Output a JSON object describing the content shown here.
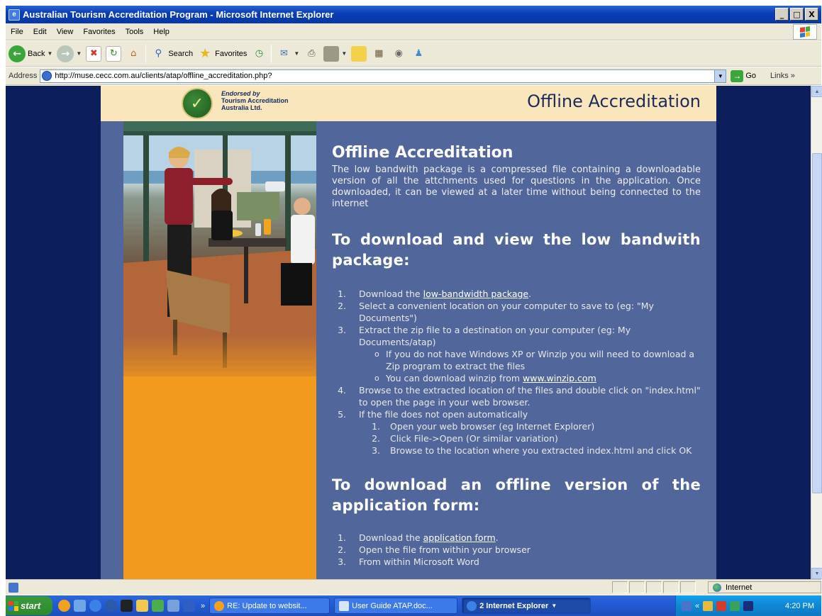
{
  "window": {
    "title": "Australian Tourism Accreditation Program - Microsoft Internet Explorer",
    "buttons": [
      "_",
      "□",
      "X"
    ]
  },
  "menu": [
    "File",
    "Edit",
    "View",
    "Favorites",
    "Tools",
    "Help"
  ],
  "toolbar": {
    "back_label": "Back",
    "search_label": "Search",
    "favorites_label": "Favorites"
  },
  "address": {
    "label": "Address",
    "url": "http://muse.cecc.com.au/clients/atap/offline_accreditation.php?",
    "go_label": "Go",
    "links_label": "Links »"
  },
  "page": {
    "endorsement": [
      "Endorsed by",
      "Tourism Accreditation",
      "Australia Ltd."
    ],
    "header_title": "Offline Accreditation",
    "heading": "Offline Accreditation",
    "intro": "The low bandwith package is a compressed file containing a downloadable version of all the attchments used for questions in the application. Once downloaded, it can be viewed at a later time without being connected to the internet",
    "section1": {
      "heading": "To download and view the low bandwith package:",
      "step1_prefix": "Download the ",
      "step1_link": "low-bandwidth package",
      "step1_suffix": ".",
      "step2": "Select a convenient location on your computer to save to (eg: \"My Documents\")",
      "step3": "Extract the zip file to a destination on your computer (eg: My Documents/atap)",
      "step3_sub1": "If you do not have Windows XP or Winzip you will need to download a Zip program to extract the files",
      "step3_sub2_prefix": "You can download winzip from ",
      "step3_sub2_link": "www.winzip.com",
      "step4": "Browse to the extracted location of the files and double click on \"index.html\" to open the page in your web browser.",
      "step5": "If the file does not open automatically",
      "step5_sub1": "Open your web browser (eg Internet Explorer)",
      "step5_sub2": "Click File->Open (Or similar variation)",
      "step5_sub3": "Browse to the location where you extracted index.html and click OK"
    },
    "section2": {
      "heading": "To download an offline version of the application form:",
      "step1_prefix": "Download the ",
      "step1_link": "application form",
      "step1_suffix": ".",
      "step2": "Open the file from within your browser",
      "step3": "From within Microsoft Word"
    }
  },
  "status": {
    "zone": "Internet"
  },
  "taskbar": {
    "start_label": "start",
    "tasks": [
      "RE: Update to websit...",
      "User Guide ATAP.doc...",
      "2 Internet Explorer"
    ],
    "clock": "4:20 PM"
  },
  "colors": {
    "page_background": "#0c1f5c",
    "content_panel": "#51669a",
    "header_band": "#f9e6bd",
    "photo_accent": "#f19a1d"
  }
}
